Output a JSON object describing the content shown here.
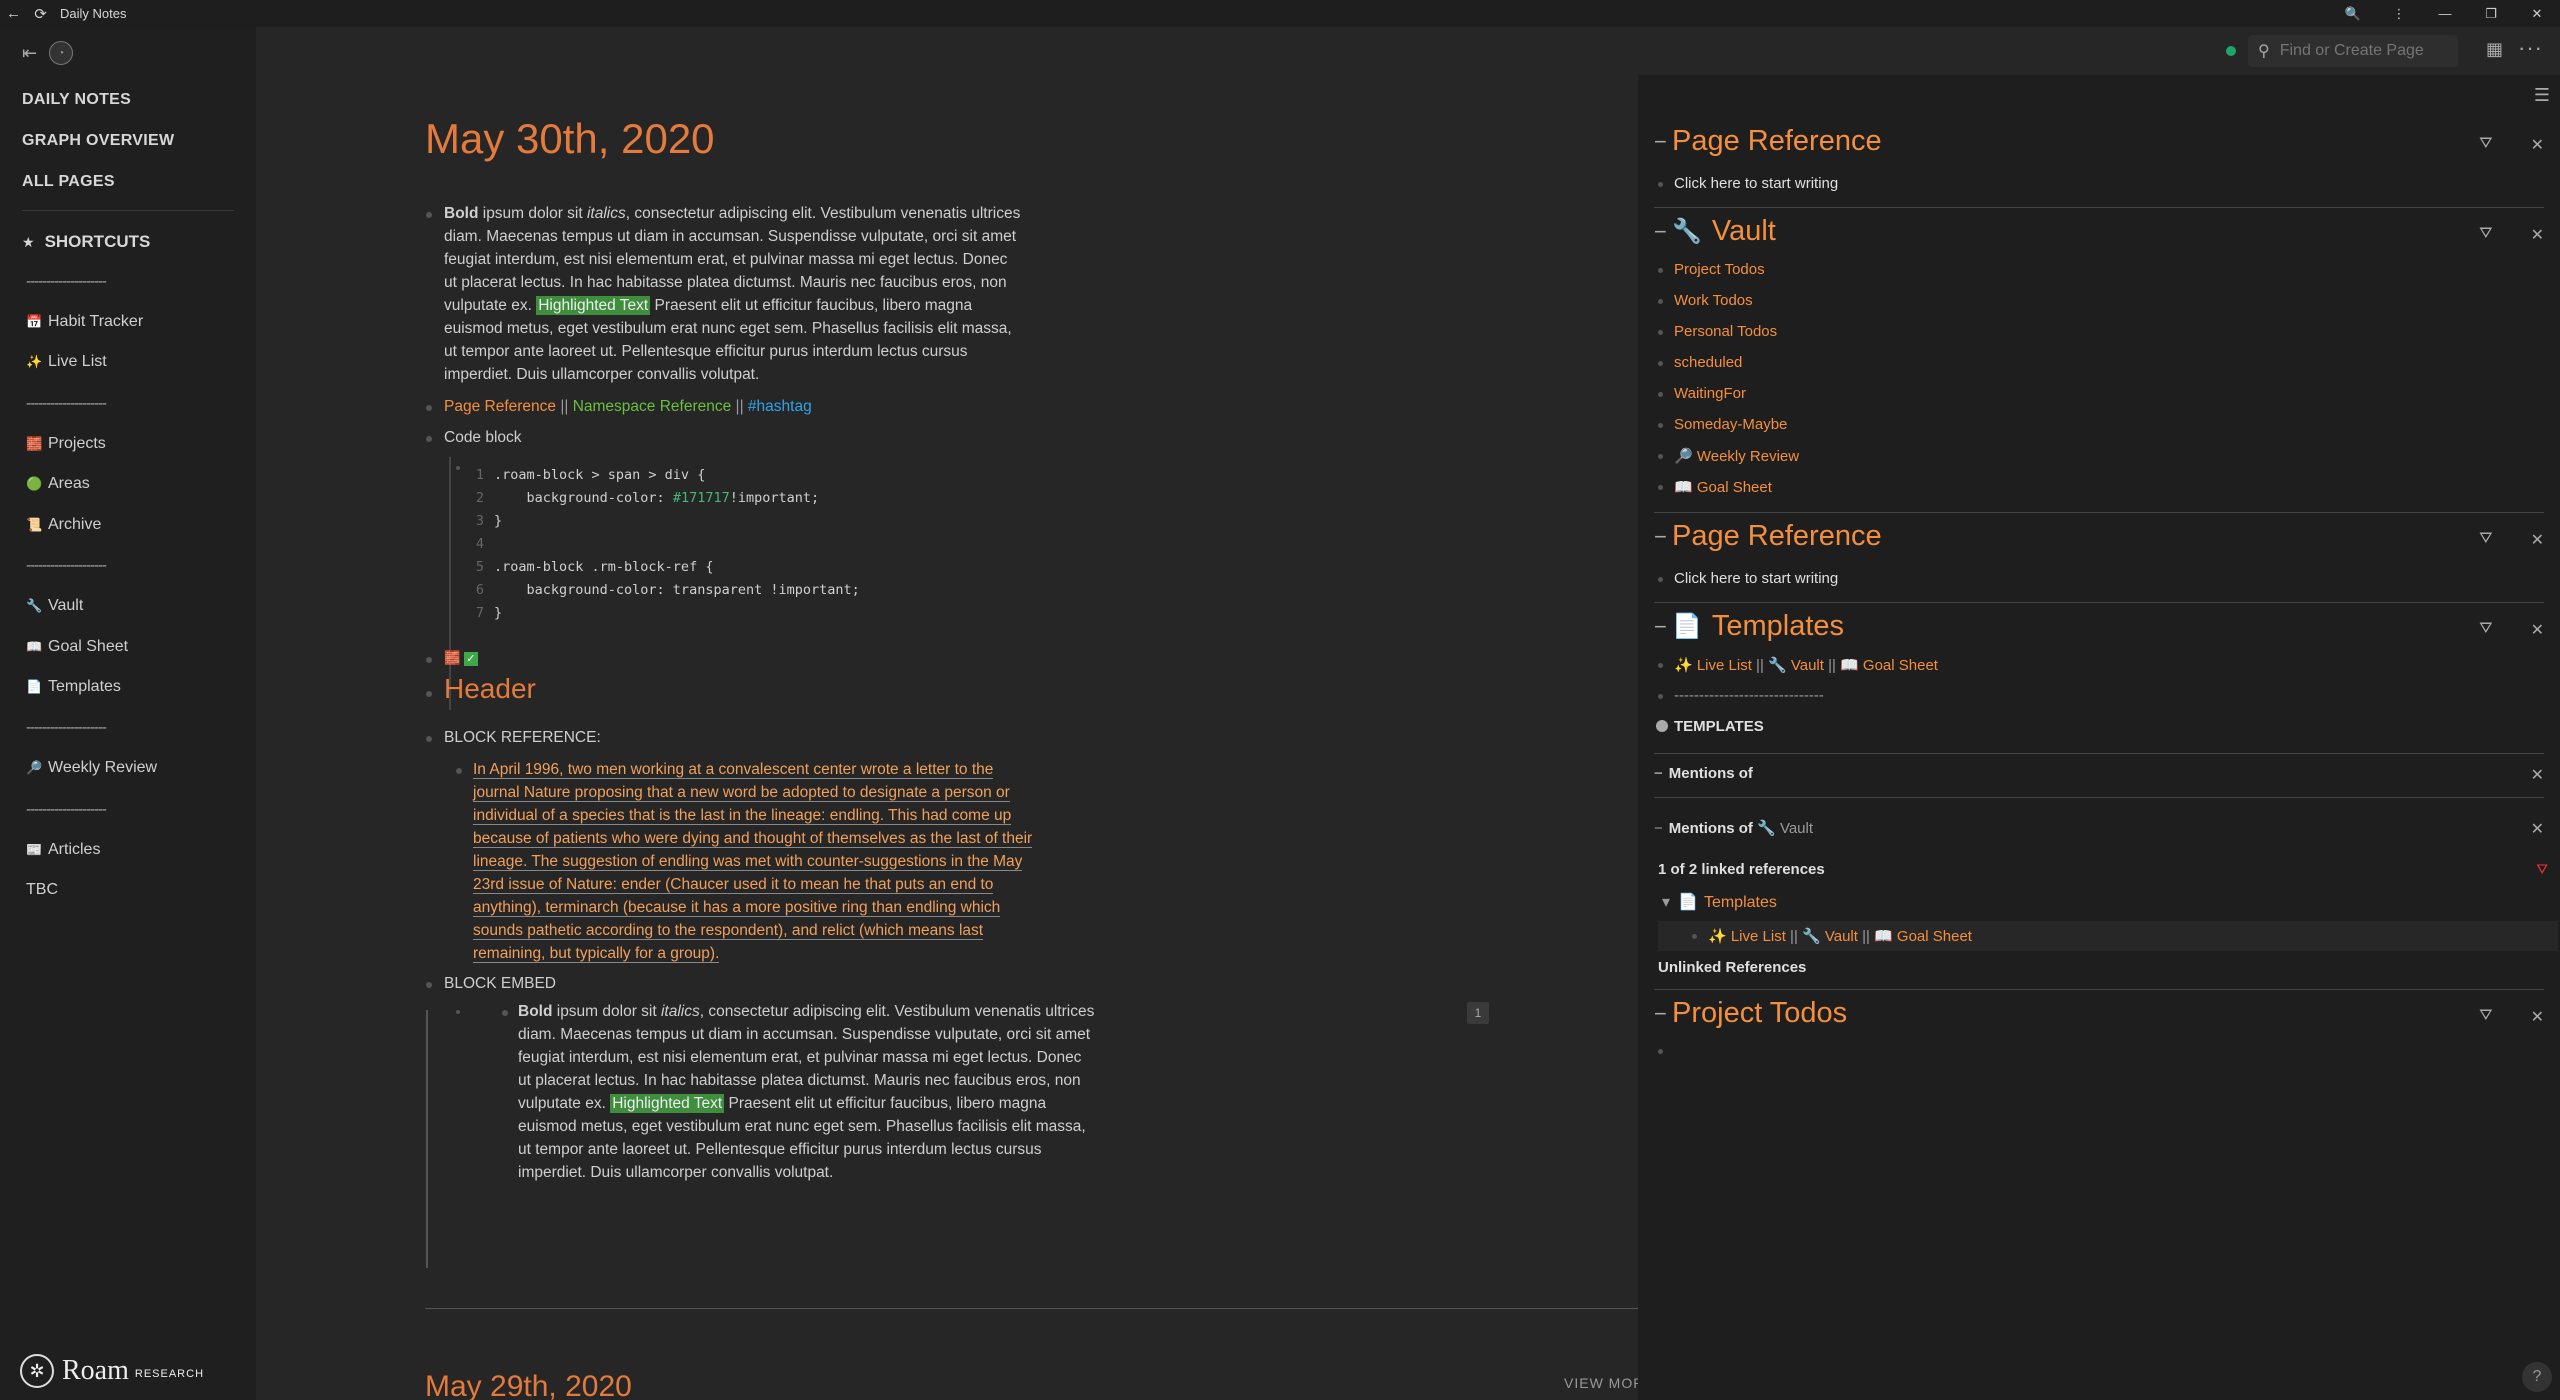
{
  "titlebar": {
    "title": "Daily Notes"
  },
  "sidebar": {
    "nav": [
      "DAILY NOTES",
      "GRAPH OVERVIEW",
      "ALL PAGES"
    ],
    "shortcuts_title": "SHORTCUTS",
    "dash": "--------------------",
    "items": [
      {
        "icon": "📅",
        "label": "Habit Tracker"
      },
      {
        "icon": "✨",
        "label": "Live List"
      },
      {
        "icon": "🧱",
        "label": "Projects"
      },
      {
        "icon": "🟢",
        "label": "Areas"
      },
      {
        "icon": "📜",
        "label": "Archive"
      },
      {
        "icon": "🔧",
        "label": "Vault"
      },
      {
        "icon": "📖",
        "label": "Goal Sheet"
      },
      {
        "icon": "📄",
        "label": "Templates"
      },
      {
        "icon": "🔎",
        "label": "Weekly Review"
      },
      {
        "icon": "📰",
        "label": "Articles"
      },
      {
        "icon": "",
        "label": "TBC"
      }
    ],
    "logo": {
      "word": "Roam",
      "sub": "RESEARCH"
    }
  },
  "topbar": {
    "search_placeholder": "Find or Create Page"
  },
  "main": {
    "title": "May 30th, 2020",
    "para_bold": "Bold",
    "para_1": " ipsum dolor sit ",
    "para_italic": "italics",
    "para_2": ", consectetur adipiscing elit. Vestibulum venenatis ultrices diam. Maecenas tempus ut diam in accumsan. Suspendisse vulputate, orci sit amet feugiat interdum, est nisi elementum erat, et pulvinar massa mi eget lectus. Donec ut placerat lectus. In hac habitasse platea dictumst. Mauris nec faucibus eros, non vulputate ex. ",
    "highlight": "Highlighted Text",
    "para_3": " Praesent elit ut efficitur faucibus, libero magna euismod metus, eget vestibulum erat nunc eget sem. Phasellus facilisis elit massa, ut tempor ante laoreet ut. Pellentesque efficitur purus interdum lectus cursus imperdiet. Duis ullamcorper convallis volutpat.",
    "ref_page": "Page Reference",
    "ref_ns": "Namespace Reference",
    "ref_tag": "#hashtag",
    "sep": " || ",
    "code_label": "Code block",
    "code_lines": [
      ".roam-block > span > div {",
      "    background-color: ",
      "}",
      "",
      ".roam-block .rm-block-ref {",
      "    background-color: transparent !important;",
      "}"
    ],
    "code_hex": "#171717",
    "code_imp": " !important;",
    "header": "Header",
    "block_ref_label": "BLOCK REFERENCE:",
    "block_ref_text": "In April 1996, two men working at a convalescent center wrote a letter to the journal Nature proposing that a new word be adopted to designate a person or individual of a species that is the last in the lineage: endling. This had come up because of patients who were dying and thought of themselves as the last of their lineage. The suggestion of endling was met with counter-suggestions in the May 23rd issue of Nature: ender (Chaucer used it to mean he that puts an end to anything), terminarch (because it has a more positive ring than endling which sounds pathetic according to the respondent), and relict (which means last remaining, but typically for a group).",
    "block_embed_label": "BLOCK EMBED",
    "embed_count": "1",
    "next_title": "May 29th, 2020",
    "view_more": "VIEW MORE"
  },
  "right": {
    "page_ref_title": "Page Reference",
    "start_writing": "Click here to start writing",
    "vault_title": "Vault",
    "vault_items": [
      "Project Todos",
      "Work Todos",
      "Personal Todos",
      "scheduled",
      "WaitingFor",
      "Someday-Maybe",
      "🔎 Weekly Review",
      "📖 Goal Sheet"
    ],
    "templates_title": "Templates",
    "templates_line": [
      "✨ Live List",
      "🔧 Vault",
      "📖 Goal Sheet"
    ],
    "templates_dashes": "------------------------------",
    "templates_caps": "TEMPLATES",
    "mentions_of": "Mentions of",
    "mentions_vault": "🔧 Vault",
    "linked_refs": "1 of 2 linked references",
    "linked_page": "Templates",
    "unlinked": "Unlinked References",
    "project_todos_title": "Project Todos"
  }
}
